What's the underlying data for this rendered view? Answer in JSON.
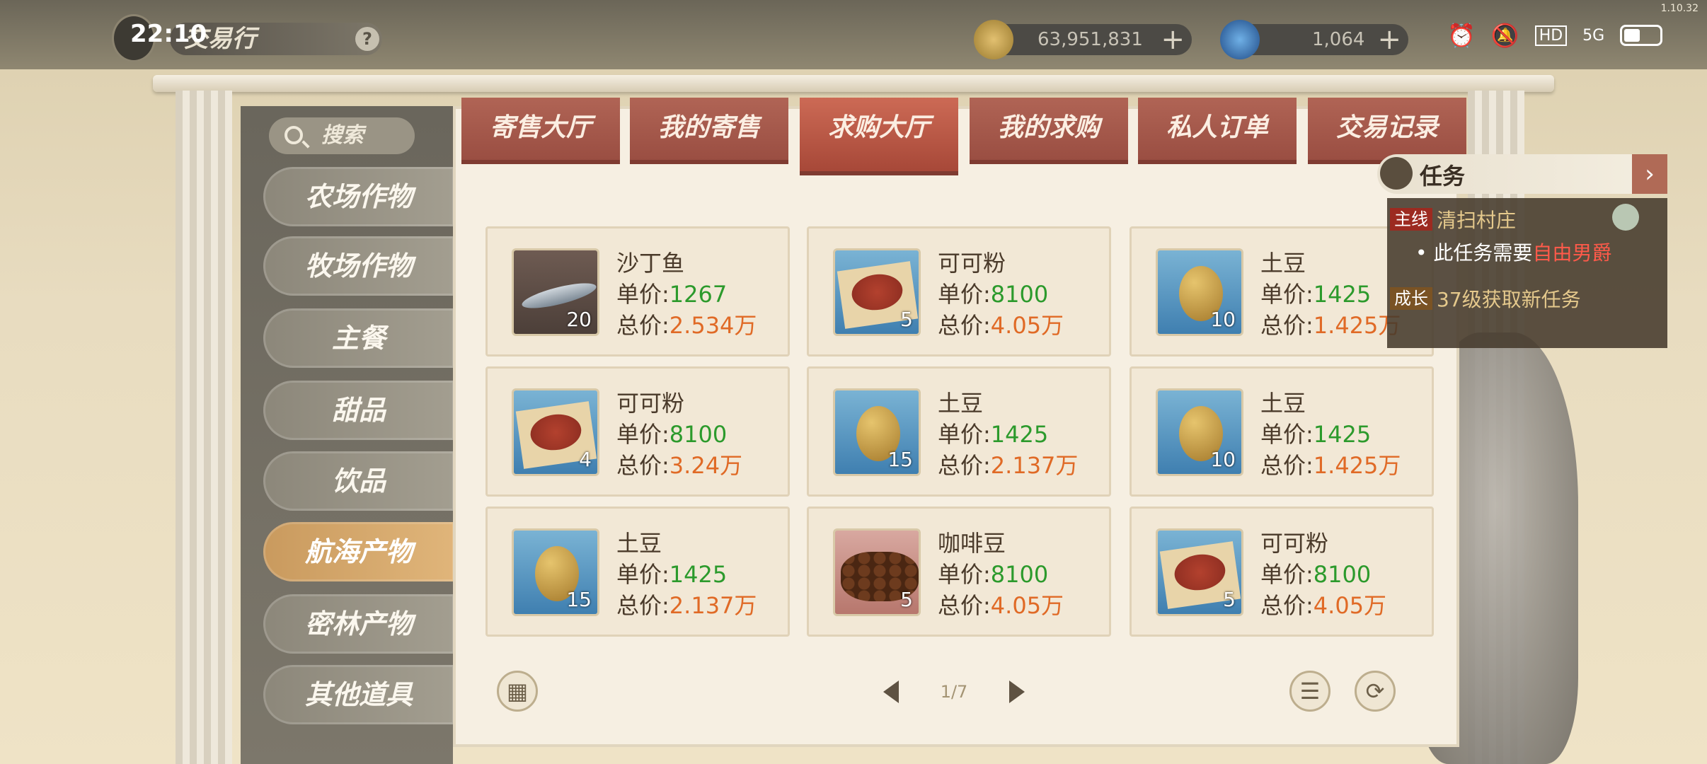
{
  "status_bar": {
    "time": "22:10",
    "hd": "HD",
    "network": "5G",
    "version": "1.10.32"
  },
  "header": {
    "title": "交易行",
    "help": "?"
  },
  "currencies": [
    {
      "value": "63,951,831",
      "plus": "+"
    },
    {
      "value": "1,064",
      "plus": "+"
    }
  ],
  "search": {
    "label": "搜索"
  },
  "categories": [
    "农场作物",
    "牧场作物",
    "主餐",
    "甜品",
    "饮品",
    "航海产物",
    "密林产物",
    "其他道具"
  ],
  "active_category": "航海产物",
  "tabs": [
    "寄售大厅",
    "我的寄售",
    "求购大厅",
    "我的求购",
    "私人订单",
    "交易记录"
  ],
  "active_tab": "求购大厅",
  "labels": {
    "unit_price": "单价:",
    "total_price": "总价:"
  },
  "items": [
    {
      "name": "沙丁鱼",
      "unit_price": "1267",
      "total_price": "2.534万",
      "qty": "20",
      "icon": "sardine-icon"
    },
    {
      "name": "可可粉",
      "unit_price": "8100",
      "total_price": "4.05万",
      "qty": "5",
      "icon": "cocoa-powder-icon"
    },
    {
      "name": "土豆",
      "unit_price": "1425",
      "total_price": "1.425万",
      "qty": "10",
      "icon": "potato-icon"
    },
    {
      "name": "可可粉",
      "unit_price": "8100",
      "total_price": "3.24万",
      "qty": "4",
      "icon": "cocoa-powder-icon"
    },
    {
      "name": "土豆",
      "unit_price": "1425",
      "total_price": "2.137万",
      "qty": "15",
      "icon": "potato-icon"
    },
    {
      "name": "土豆",
      "unit_price": "1425",
      "total_price": "1.425万",
      "qty": "10",
      "icon": "potato-icon"
    },
    {
      "name": "土豆",
      "unit_price": "1425",
      "total_price": "2.137万",
      "qty": "15",
      "icon": "potato-icon"
    },
    {
      "name": "咖啡豆",
      "unit_price": "8100",
      "total_price": "4.05万",
      "qty": "5",
      "icon": "coffee-bean-icon"
    },
    {
      "name": "可可粉",
      "unit_price": "8100",
      "total_price": "4.05万",
      "qty": "5",
      "icon": "cocoa-powder-icon"
    }
  ],
  "pagination": {
    "page": "1/7"
  },
  "quest": {
    "title": "任务",
    "main_tag": "主线",
    "main_name": "清扫村庄",
    "main_req_prefix": "此任务需要",
    "main_req_highlight": "自由男爵",
    "grow_tag": "成长",
    "grow_text": "37级获取新任务"
  },
  "colors": {
    "unit_price": "#2c9a2c",
    "total_price": "#e06a26",
    "tab": "#a74838",
    "active_category": "#e0b57a"
  }
}
